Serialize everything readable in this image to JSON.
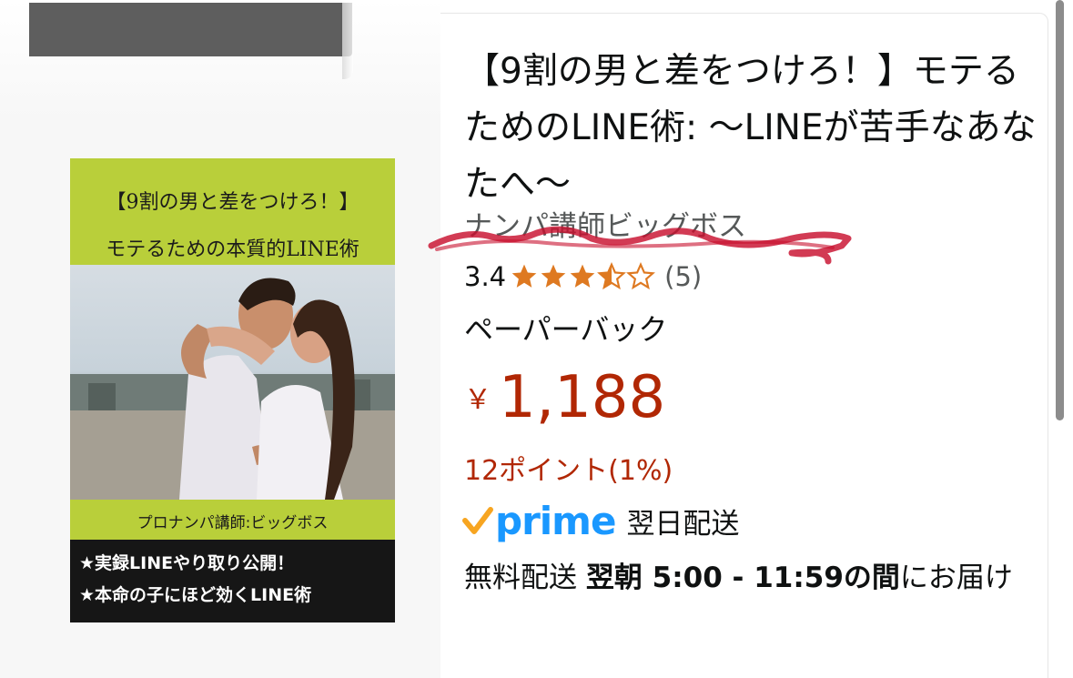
{
  "product": {
    "title": "【9割の男と差をつけろ！】モテるためのLINE術: 〜LINEが苦手なあなたへ〜",
    "author": "ナンパ講師ビッグボス",
    "rating": {
      "value": "3.4",
      "stars": 3.5,
      "count": "(5)"
    },
    "format": "ペーパーバック",
    "price": {
      "symbol": "￥",
      "value": "1,188"
    },
    "points": "12ポイント(1%)",
    "prime": {
      "label": "prime",
      "delivery": "翌日配送"
    },
    "shipping": {
      "prefix": "無料配送",
      "bold": "翌朝 5:00 - 11:59の間",
      "suffix": "にお届け"
    }
  },
  "cover": {
    "title_line1": "【9割の男と差をつけろ！】",
    "title_line2": "モテるための本質的LINE術",
    "author": "プロナンパ講師:ビッグボス",
    "bullet1": "★実録LINEやり取り公開！",
    "bullet2": "★本命の子にほど効くLINE術"
  },
  "colors": {
    "price": "#b12704",
    "star": "#de7921",
    "prime_blue": "#1a98ff",
    "prime_check": "#f7a521",
    "strike": "#c8102e",
    "cover_green": "#b9cf3a"
  }
}
